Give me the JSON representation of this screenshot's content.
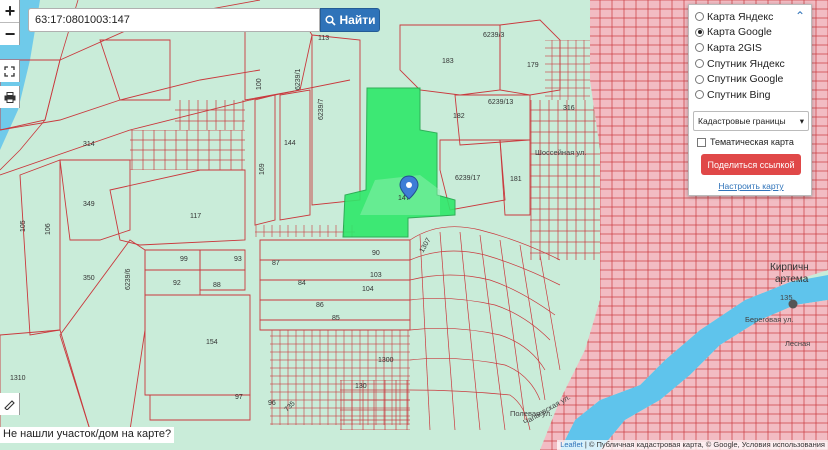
{
  "search": {
    "value": "63:17:0801003:147",
    "button_label": "Найти"
  },
  "map_controls": {
    "zoom_in": "+",
    "zoom_out": "−"
  },
  "layers": {
    "items": [
      {
        "label": "Карта Яндекс",
        "selected": false
      },
      {
        "label": "Карта Google",
        "selected": true
      },
      {
        "label": "Карта 2GIS",
        "selected": false
      },
      {
        "label": "Спутник Яндекс",
        "selected": false
      },
      {
        "label": "Спутник Google",
        "selected": false
      },
      {
        "label": "Спутник Bing",
        "selected": false
      }
    ],
    "overlay_select": "Кадастровые границы",
    "thematic_label": "Тематическая карта",
    "share_label": "Поделиться ссылкой",
    "settings_link": "Настроить карту"
  },
  "not_found_text": "Не нашли участок/дом на карте?",
  "attribution": {
    "leaflet": "Leaflet",
    "text": "| © Публичная кадастровая карта, © Google, Условия использования"
  },
  "map_labels": {
    "parcels": [
      "113",
      "6239/3",
      "183",
      "179",
      "100",
      "6239/1",
      "6239/7",
      "182",
      "6239/13",
      "316",
      "314",
      "144",
      "169",
      "6239/17",
      "181",
      "117",
      "349",
      "105",
      "106",
      "99",
      "93",
      "90",
      "1307",
      "87",
      "103",
      "350",
      "92",
      "88",
      "84",
      "104",
      "6239/6",
      "86",
      "85",
      "154",
      "1300",
      "130",
      "97",
      "96",
      "735",
      "1310"
    ],
    "selected_parcel": "147",
    "street_1": "Шоссейная ул.",
    "street_2": "Полевая ул.",
    "street_3": "Чапаевская ул.",
    "street_4": "Береговая ул.",
    "street_5": "Лесная",
    "place_name_1": "Кирпичн",
    "place_name_2": "артема",
    "number_1": "135"
  },
  "colors": {
    "map_bg": "#c9ecd9",
    "parcel_stroke": "#c9393d",
    "selected_fill": "#2ee86a",
    "water": "#5fc4ec",
    "marker": "#3e7dd6",
    "search_button": "#2f73b9",
    "share_button": "#e04848"
  }
}
